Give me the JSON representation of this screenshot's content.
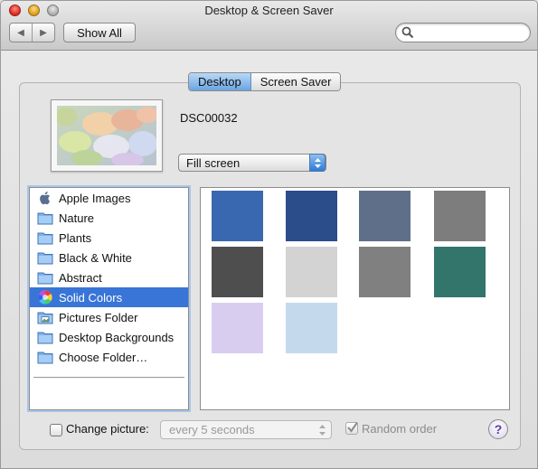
{
  "window": {
    "title": "Desktop & Screen Saver"
  },
  "toolbar": {
    "back_glyph": "◀",
    "forward_glyph": "▶",
    "show_all_label": "Show All",
    "search_placeholder": "",
    "search_icon": "magnifier-icon"
  },
  "tabs": [
    {
      "label": "Desktop",
      "selected": true
    },
    {
      "label": "Screen Saver",
      "selected": false
    }
  ],
  "preview": {
    "image_name": "DSC00032",
    "scaling_selected": "Fill screen"
  },
  "source_list": {
    "items": [
      {
        "label": "Apple Images",
        "icon": "apple-icon",
        "selected": false
      },
      {
        "label": "Nature",
        "icon": "folder-icon",
        "selected": false
      },
      {
        "label": "Plants",
        "icon": "folder-icon",
        "selected": false
      },
      {
        "label": "Black & White",
        "icon": "folder-icon",
        "selected": false
      },
      {
        "label": "Abstract",
        "icon": "folder-icon",
        "selected": false
      },
      {
        "label": "Solid Colors",
        "icon": "color-wheel-icon",
        "selected": true
      },
      {
        "label": "Pictures Folder",
        "icon": "pictures-folder-icon",
        "selected": false
      },
      {
        "label": "Desktop Backgrounds",
        "icon": "folder-icon",
        "selected": false
      },
      {
        "label": "Choose Folder…",
        "icon": "folder-icon",
        "selected": false
      }
    ]
  },
  "swatches": [
    {
      "color": "#3a68b0"
    },
    {
      "color": "#2b4d8a"
    },
    {
      "color": "#5f6f8a"
    },
    {
      "color": "#7d7d7d"
    },
    {
      "color": "#4e4e4e"
    },
    {
      "color": "#d3d3d3"
    },
    {
      "color": "#808080"
    },
    {
      "color": "#33756a"
    },
    {
      "color": "#d9cdef"
    },
    {
      "color": "#c5d9ec"
    }
  ],
  "bottom": {
    "change_picture_label": "Change picture:",
    "change_picture_checked": false,
    "interval_selected": "every 5 seconds",
    "random_order_label": "Random order",
    "random_order_checked": true,
    "help_label": "?"
  },
  "colors": {
    "selection": "#3875d7",
    "tab_active": "#6aa5e2"
  }
}
